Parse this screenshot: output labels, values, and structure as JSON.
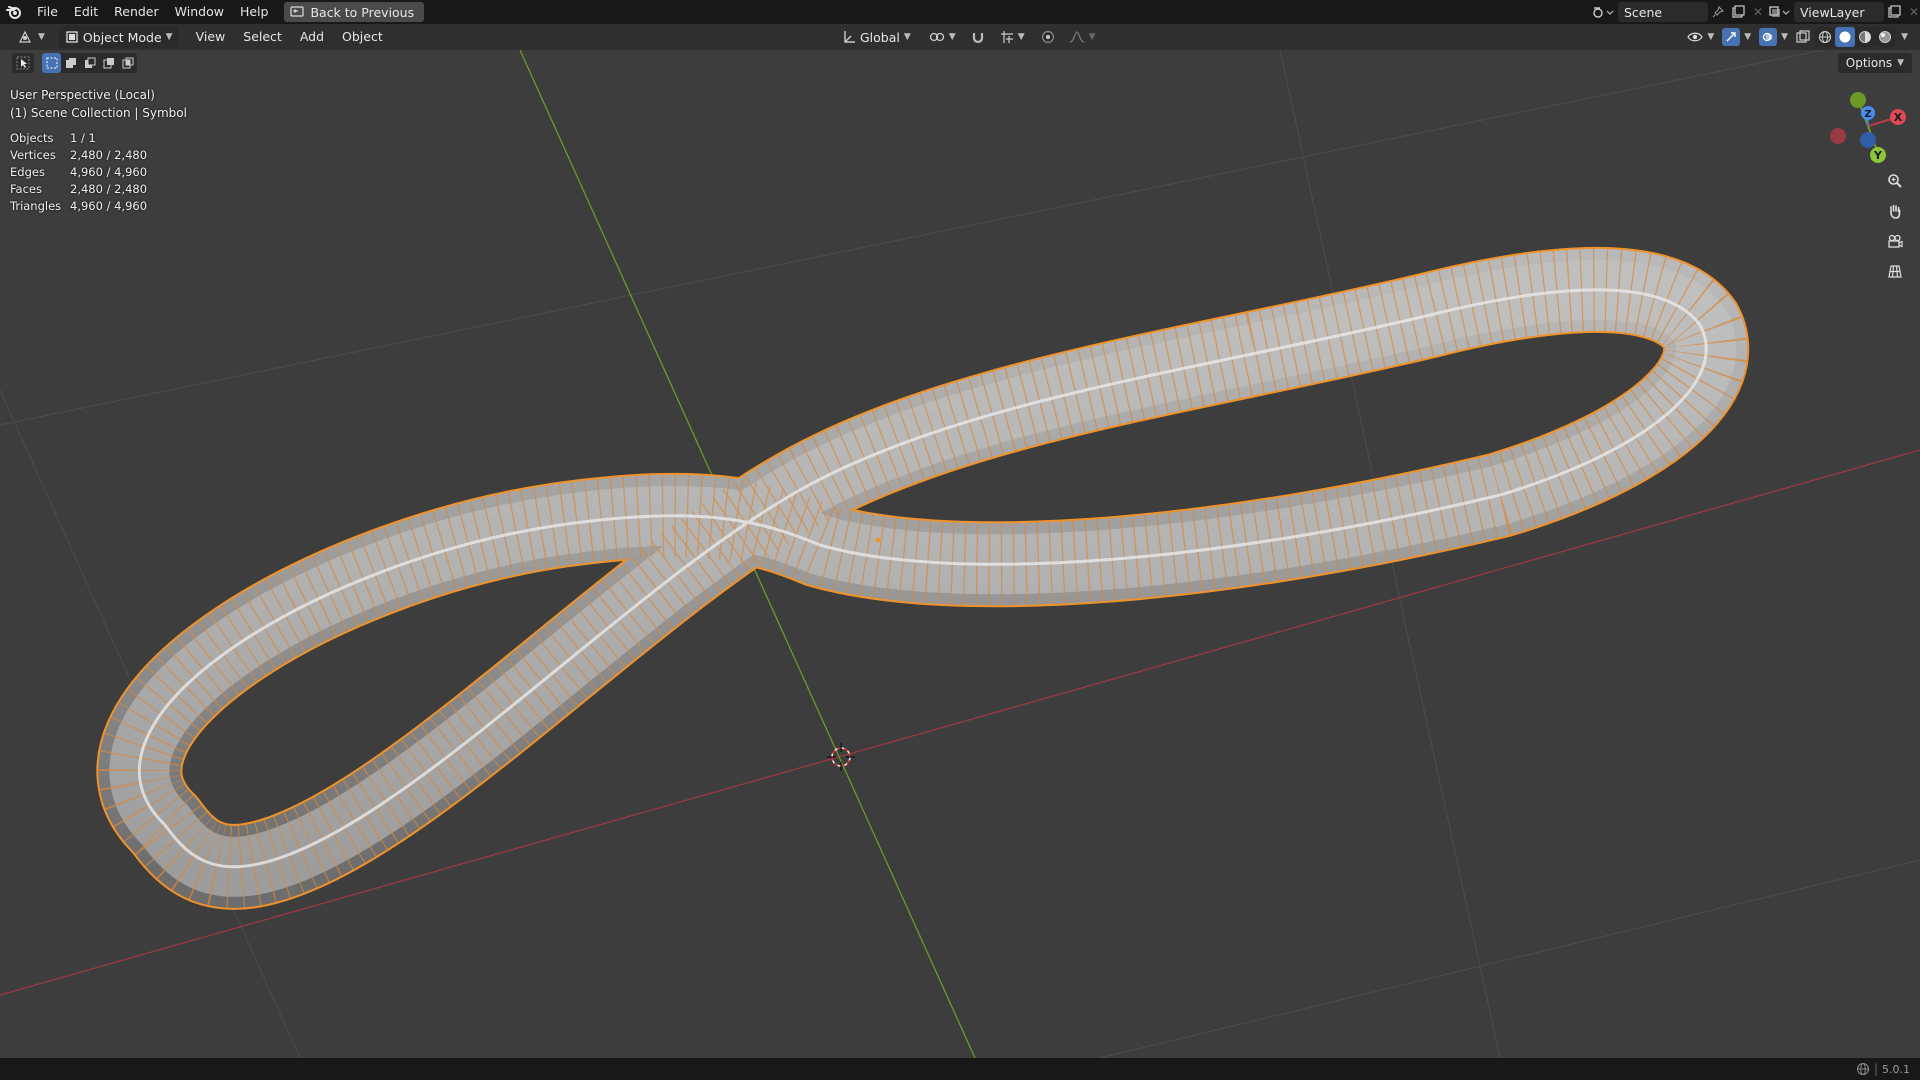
{
  "menu": {
    "items": [
      "File",
      "Edit",
      "Render",
      "Window",
      "Help"
    ],
    "back_label": "Back to Previous"
  },
  "scene": {
    "name": "Scene"
  },
  "view_layer": {
    "name": "ViewLayer"
  },
  "header": {
    "mode_label": "Object Mode",
    "menus": [
      "View",
      "Select",
      "Add",
      "Object"
    ],
    "orientation_label": "Global"
  },
  "options_label": "Options",
  "viewport_overlay": {
    "perspective": "User Perspective (Local)",
    "collection": "(1) Scene Collection | Symbol"
  },
  "stats": [
    {
      "label": "Objects",
      "value": "1 / 1"
    },
    {
      "label": "Vertices",
      "value": "2,480 / 2,480"
    },
    {
      "label": "Edges",
      "value": "4,960 / 4,960"
    },
    {
      "label": "Faces",
      "value": "2,480 / 2,480"
    },
    {
      "label": "Triangles",
      "value": "4,960 / 4,960"
    }
  ],
  "gizmo": {
    "x_label": "X",
    "y_label": "Y",
    "z_label": "Z"
  },
  "status": {
    "version": "5.0.1"
  },
  "colors": {
    "accent": "#4772b3",
    "selection": "#f0922a",
    "axis_x": "#b83b46",
    "axis_y": "#6c9a25",
    "axis_z": "#3a78d6"
  }
}
